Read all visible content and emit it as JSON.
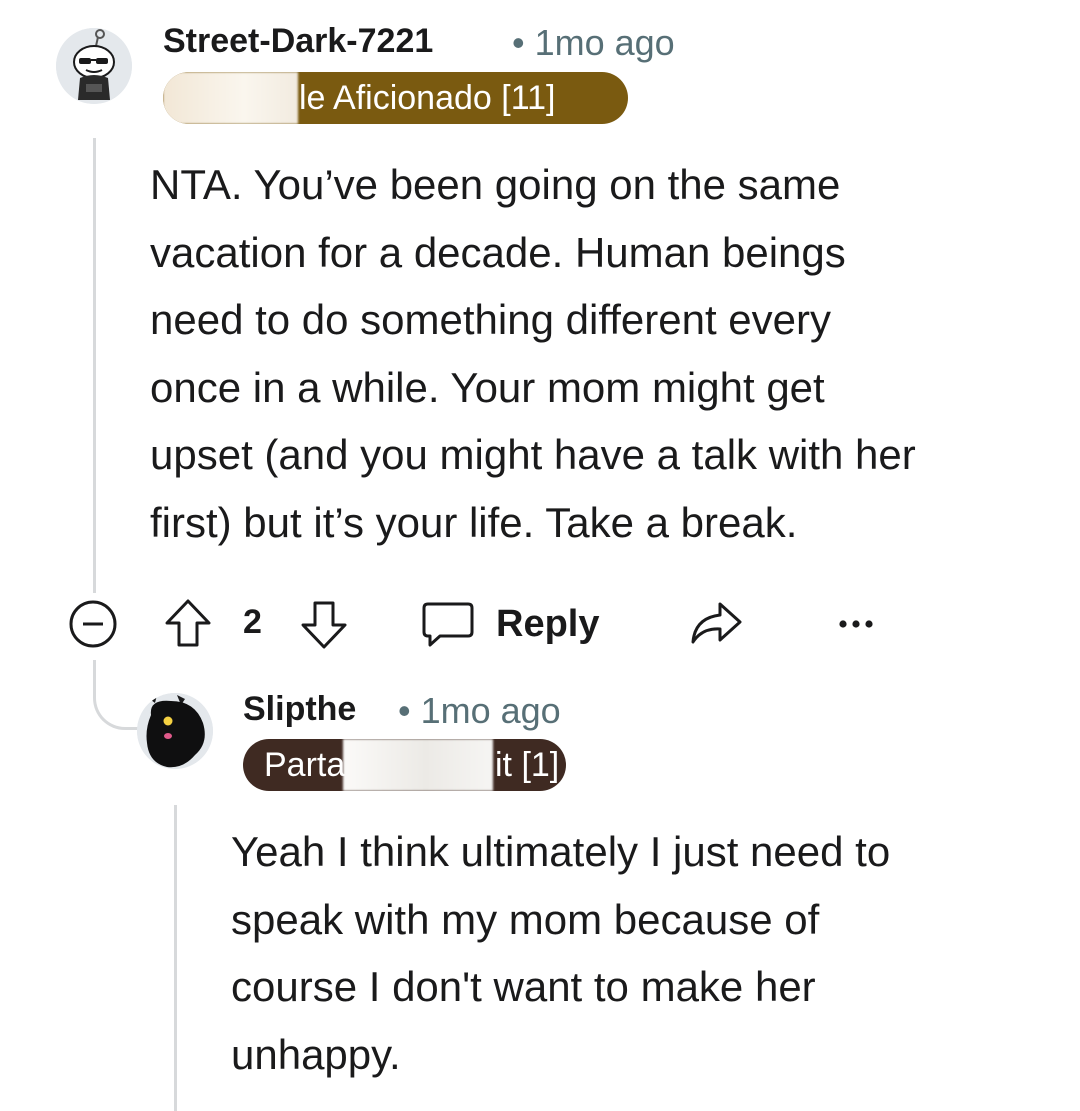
{
  "comment": {
    "author": "Street-Dark-7221",
    "meta": "• 1mo ago",
    "flair": "le Aficionado [11]",
    "body_lines": [
      "NTA. You’ve been going on the same",
      "vacation for a decade. Human beings",
      "need to do something different every",
      "once in a while. Your mom might get",
      "upset (and you might have a talk with her",
      "first) but it’s your life. Take a break."
    ],
    "votes": "2",
    "reply_label": "Reply"
  },
  "reply": {
    "author": "Slipthe",
    "meta": "• 1mo ago",
    "flair_start": "Parta",
    "flair_end": "it [1]",
    "body_lines": [
      "Yeah I think ultimately I just need to",
      "speak with my mom because of",
      "course I don't want to make her",
      "unhappy."
    ]
  },
  "icons": {
    "collapse": "minus-circle-icon",
    "upvote": "arrow-up-icon",
    "downvote": "arrow-down-icon",
    "reply": "speech-bubble-icon",
    "share": "share-arrow-icon",
    "more": "ellipsis-icon"
  },
  "colors": {
    "flair_top": "#7a5a10",
    "flair_reply": "#3f2a22",
    "meta_text": "#576f76",
    "thread_line": "#d7d9db"
  }
}
